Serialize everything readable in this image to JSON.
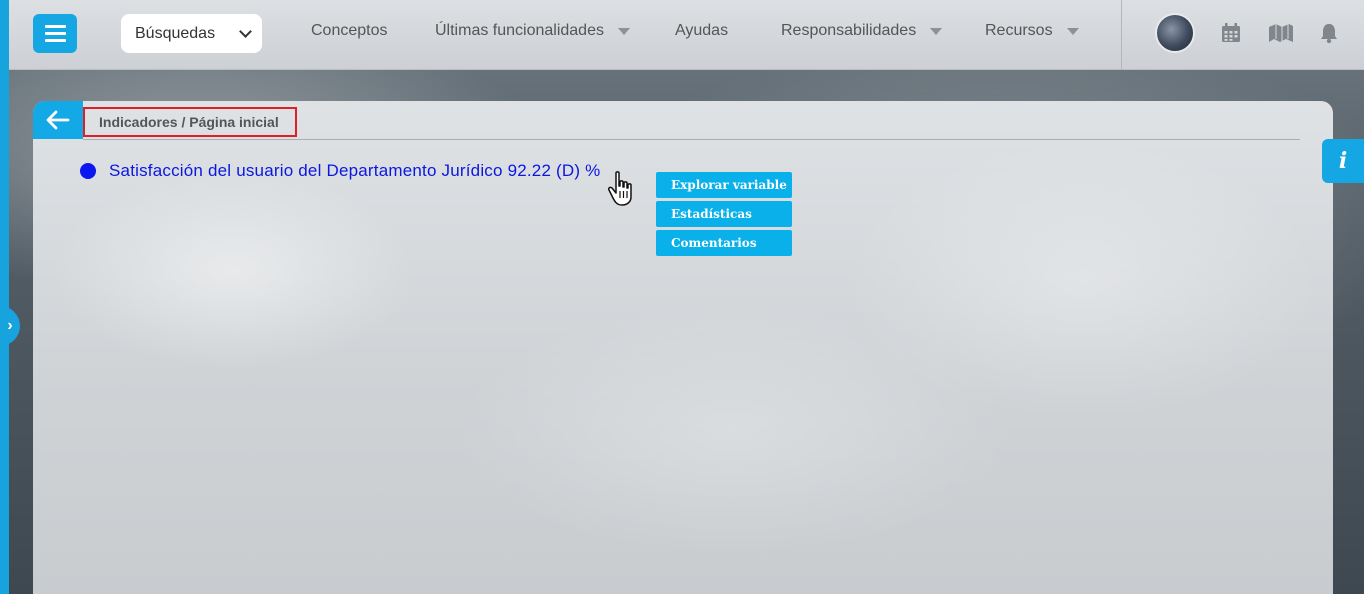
{
  "topbar": {
    "search_select_value": "Búsquedas",
    "nav": [
      {
        "label": "Conceptos",
        "has_dropdown": false
      },
      {
        "label": "Últimas funcionalidades",
        "has_dropdown": true
      },
      {
        "label": "Ayudas",
        "has_dropdown": false
      },
      {
        "label": "Responsabilidades",
        "has_dropdown": true
      },
      {
        "label": "Recursos",
        "has_dropdown": true
      }
    ],
    "icons": [
      "menu-icon",
      "chevron-down-icon",
      "avatar",
      "calendar-icon",
      "map-icon",
      "bell-icon"
    ]
  },
  "card": {
    "breadcrumb": "Indicadores / Página inicial",
    "indicator": {
      "label": "Satisfacción del usuario del Departamento Jurídico 92.22 (D) %",
      "status_color": "#0b17f0"
    },
    "context_menu": [
      "Explorar variable",
      "Estadísticas",
      "Comentarios"
    ]
  },
  "info_tab_label": "i",
  "colors": {
    "accent": "#14a7e3",
    "link": "#0b17e0",
    "highlight_border": "#e01e25"
  }
}
